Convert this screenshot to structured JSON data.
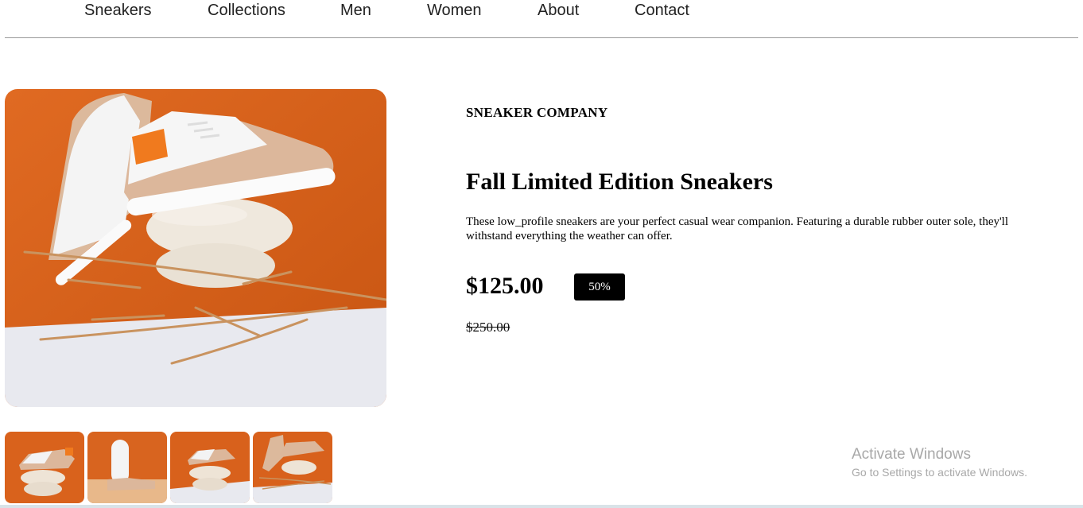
{
  "nav": {
    "items": [
      {
        "label": "Sneakers"
      },
      {
        "label": "Collections"
      },
      {
        "label": "Men"
      },
      {
        "label": "Women"
      },
      {
        "label": "About"
      },
      {
        "label": "Contact"
      }
    ]
  },
  "product": {
    "company": "SNEAKER COMPANY",
    "title": "Fall Limited Edition Sneakers",
    "description": "These low_profile sneakers are your perfect casual wear companion. Featuring a durable rubber outer sole, they'll withstand everything the weather can offer.",
    "price": "$125.00",
    "discount": "50%",
    "original_price": "$250.00"
  },
  "gallery": {
    "main_image": "sneaker-product-photo",
    "thumbnails": [
      "thumbnail-1",
      "thumbnail-2",
      "thumbnail-3",
      "thumbnail-4"
    ]
  },
  "watermark": {
    "title": "Activate Windows",
    "subtitle": "Go to Settings to activate Windows."
  },
  "colors": {
    "accent_orange": "#d8611c",
    "badge_bg": "#000000",
    "watermark": "#a8a8a8"
  }
}
